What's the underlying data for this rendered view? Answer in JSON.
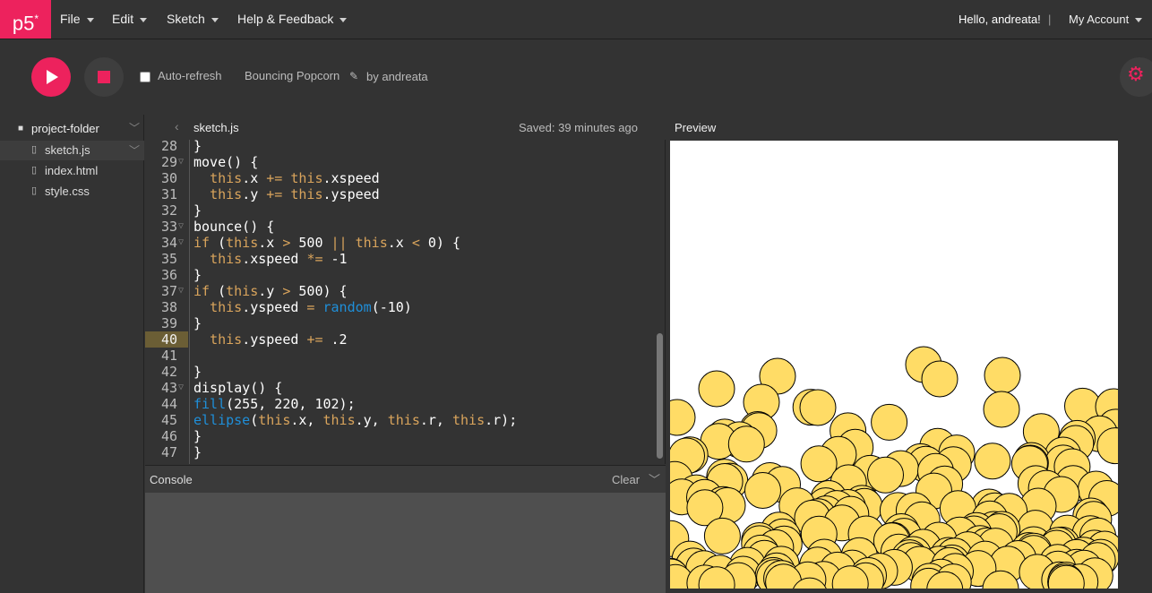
{
  "nav": {
    "logo": "p5",
    "logo_mark": "*",
    "menus": [
      {
        "label": "File"
      },
      {
        "label": "Edit"
      },
      {
        "label": "Sketch"
      },
      {
        "label": "Help & Feedback"
      }
    ],
    "greeting": "Hello, andreata!",
    "separator": "|",
    "account_label": "My Account"
  },
  "toolbar": {
    "auto_refresh_label": "Auto-refresh",
    "auto_refresh_checked": false,
    "sketch_name": "Bouncing Popcorn",
    "byline": "by andreata"
  },
  "sidebar": {
    "folder": "project-folder",
    "files": [
      {
        "label": "sketch.js",
        "active": true
      },
      {
        "label": "index.html",
        "active": false
      },
      {
        "label": "style.css",
        "active": false
      }
    ]
  },
  "editor": {
    "tab_name": "sketch.js",
    "saved_status": "Saved: 39 minutes ago",
    "highlighted_line": 40,
    "lines": [
      {
        "n": "28",
        "fold": false,
        "code": "}"
      },
      {
        "n": "29",
        "fold": true,
        "code": "move() {"
      },
      {
        "n": "30",
        "fold": false,
        "code": "  this.x += this.xspeed"
      },
      {
        "n": "31",
        "fold": false,
        "code": "  this.y += this.yspeed"
      },
      {
        "n": "32",
        "fold": false,
        "code": "}"
      },
      {
        "n": "33",
        "fold": true,
        "code": "bounce() {"
      },
      {
        "n": "34",
        "fold": true,
        "code": "if (this.x > 500 || this.x < 0) {"
      },
      {
        "n": "35",
        "fold": false,
        "code": "  this.xspeed *= -1"
      },
      {
        "n": "36",
        "fold": false,
        "code": "}"
      },
      {
        "n": "37",
        "fold": true,
        "code": "if (this.y > 500) {"
      },
      {
        "n": "38",
        "fold": false,
        "code": "  this.yspeed = random(-10)"
      },
      {
        "n": "39",
        "fold": false,
        "code": "}"
      },
      {
        "n": "40",
        "fold": false,
        "code": "  this.yspeed += .2"
      },
      {
        "n": "41",
        "fold": false,
        "code": ""
      },
      {
        "n": "42",
        "fold": false,
        "code": "}"
      },
      {
        "n": "43",
        "fold": true,
        "code": "display() {"
      },
      {
        "n": "44",
        "fold": false,
        "code": "fill(255, 220, 102);"
      },
      {
        "n": "45",
        "fold": false,
        "code": "ellipse(this.x, this.y, this.r, this.r);"
      },
      {
        "n": "46",
        "fold": false,
        "code": "}"
      },
      {
        "n": "47",
        "fold": false,
        "code": "}"
      }
    ]
  },
  "console": {
    "title": "Console",
    "clear_label": "Clear"
  },
  "preview": {
    "title": "Preview",
    "ball_fill": "#ffdc66",
    "ball_stroke": "#000000"
  },
  "colors": {
    "accent": "#ed225d",
    "keyword": "#d9a45c",
    "function": "#1f8fd9"
  }
}
